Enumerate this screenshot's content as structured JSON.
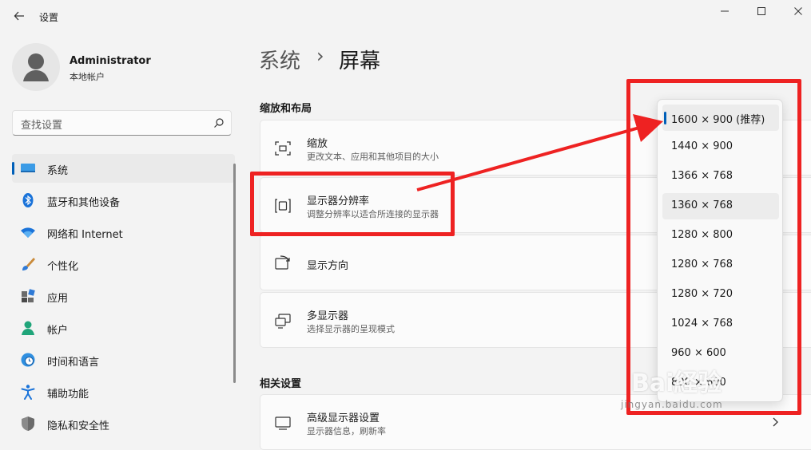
{
  "window": {
    "title": "设置"
  },
  "profile": {
    "name": "Administrator",
    "account": "本地帐户"
  },
  "search": {
    "placeholder": "查找设置"
  },
  "nav": {
    "items": [
      {
        "label": "系统",
        "icon": "system-icon"
      },
      {
        "label": "蓝牙和其他设备",
        "icon": "bluetooth-icon"
      },
      {
        "label": "网络和 Internet",
        "icon": "wifi-icon"
      },
      {
        "label": "个性化",
        "icon": "brush-icon"
      },
      {
        "label": "应用",
        "icon": "apps-icon"
      },
      {
        "label": "帐户",
        "icon": "account-icon"
      },
      {
        "label": "时间和语言",
        "icon": "clock-globe-icon"
      },
      {
        "label": "辅助功能",
        "icon": "accessibility-icon"
      },
      {
        "label": "隐私和安全性",
        "icon": "shield-icon"
      }
    ],
    "active_index": 0
  },
  "breadcrumb": {
    "parent": "系统",
    "separator": "›",
    "current": "屏幕"
  },
  "sections": {
    "layout": "缩放和布局",
    "related": "相关设置"
  },
  "cards": {
    "scale": {
      "title": "缩放",
      "subtitle": "更改文本、应用和其他项目的大小"
    },
    "resolution": {
      "title": "显示器分辨率",
      "subtitle": "调整分辨率以适合所连接的显示器"
    },
    "orientation": {
      "title": "显示方向"
    },
    "multi": {
      "title": "多显示器",
      "subtitle": "选择显示器的呈现模式"
    },
    "advanced": {
      "title": "高级显示器设置",
      "subtitle": "显示器信息，刷新率"
    }
  },
  "resolution_dropdown": {
    "options": [
      "1600 × 900 (推荐)",
      "1440 × 900",
      "1366 × 768",
      "1360 × 768",
      "1280 × 800",
      "1280 × 768",
      "1280 × 720",
      "1024 × 768",
      "960 × 600",
      "800 × 600"
    ],
    "selected_index": 0,
    "hover_index": 3
  },
  "watermark": {
    "brand": "Bai経验",
    "url": "jingyan.baidu.com"
  },
  "colors": {
    "accent": "#005fb8",
    "annotation": "#ee2222",
    "background": "#f3f3f3"
  }
}
